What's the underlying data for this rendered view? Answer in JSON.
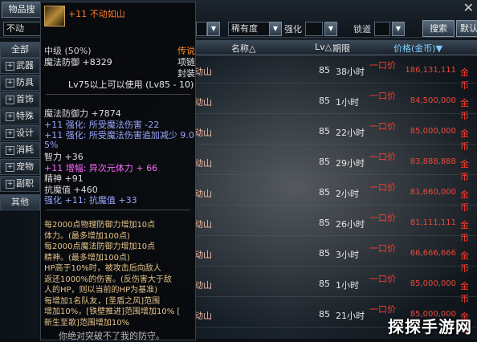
{
  "topbar": {
    "tab_label": "物品搜",
    "close": "✕",
    "search_value": "不动",
    "quality_label": "稀有度",
    "enhance_label": "强化",
    "lock_label": "锁道",
    "search_button": "搜索",
    "default_button": "默认"
  },
  "categories": {
    "all": "全部",
    "items": [
      "武器",
      "防具",
      "首饰",
      "特殊",
      "设计",
      "消耗",
      "宠物",
      "副职"
    ],
    "other": "其他"
  },
  "table": {
    "headers": {
      "name": "名称△",
      "lv": "Lv△",
      "time": "期限",
      "price": "价格(金币)▼"
    },
    "rows": [
      {
        "name": "动山",
        "lv": "85",
        "time": "38小时",
        "bid": "一口价",
        "price": "186,131,111",
        "unit": "金币"
      },
      {
        "name": "动山",
        "lv": "85",
        "time": "1小时",
        "bid": "一口价",
        "price": "84,500,000",
        "unit": "金币"
      },
      {
        "name": "动山",
        "lv": "85",
        "time": "22小时",
        "bid": "一口价",
        "price": "85,000,000",
        "unit": "金币"
      },
      {
        "name": "动山",
        "lv": "85",
        "time": "29小时",
        "bid": "一口价",
        "price": "83,888,888",
        "unit": "金币"
      },
      {
        "name": "动山",
        "lv": "85",
        "time": "2小时",
        "bid": "一口价",
        "price": "81,660,000",
        "unit": "金币"
      },
      {
        "name": "动山",
        "lv": "85",
        "time": "26小时",
        "bid": "一口价",
        "price": "81,111,111",
        "unit": "金币"
      },
      {
        "name": "动山",
        "lv": "85",
        "time": "3小时",
        "bid": "一口价",
        "price": "66,666,666",
        "unit": "金币"
      },
      {
        "name": "动山",
        "lv": "85",
        "time": "1小时",
        "bid": "一口价",
        "price": "85,000,000",
        "unit": "金币"
      },
      {
        "name": "动山",
        "lv": "85",
        "time": "21小时",
        "bid": "一口价",
        "price": "85,000,000",
        "unit": "金币"
      }
    ]
  },
  "tooltip": {
    "title": "+11 不动如山",
    "grade": "中级 (50%)",
    "tag1": "传说",
    "type": "魔法防御 +8329",
    "tag2": "项链",
    "tag3": "封装",
    "req": "Lv75以上可以使用 (Lv85 - 10)",
    "stats": [
      {
        "text": "魔法防御力 +7874",
        "color": "#dcdcdc"
      },
      {
        "text": "+11 强化: 所受魔法伤害 -22",
        "color": "#9aa6ff"
      },
      {
        "text": "+11 强化: 所受魔法伤害追加减少 9.0",
        "color": "#9aa6ff"
      },
      {
        "text": "5%",
        "color": "#9aa6ff"
      },
      {
        "text": "智力 +36",
        "color": "#dcdcdc"
      },
      {
        "text": "+11 增幅: 异次元体力 + 66",
        "color": "#ff66ff"
      },
      {
        "text": "精神 +91",
        "color": "#dcdcdc"
      },
      {
        "text": "抗魔值 +460",
        "color": "#dcdcdc"
      },
      {
        "text": "强化 +11: 抗魔值 +33",
        "color": "#9aa6ff"
      }
    ],
    "desc": [
      "每2000点物理防御力增加10点",
      "体力。(最多增加100点)",
      "每2000点魔法防御力增加10点",
      "精神。(最多增加100点)",
      "HP高于10%时，被攻击后向敌人",
      "返还1000%的伤害。(反伤害大于敌",
      "人的HP，则以当前的HP为基准)",
      "每增加1名队友，[圣盾之风]范围",
      "增加10%，[铁壁推进]范围增加10% [",
      "新生至歌]范围增加10%"
    ],
    "flavor": "你绝对突破不了我的防守。"
  },
  "watermark": "探探手游网",
  "colors": {
    "price_red": "#e84a3a",
    "bid_red": "#ff3c2a",
    "title_orange": "#ff7a2a"
  }
}
